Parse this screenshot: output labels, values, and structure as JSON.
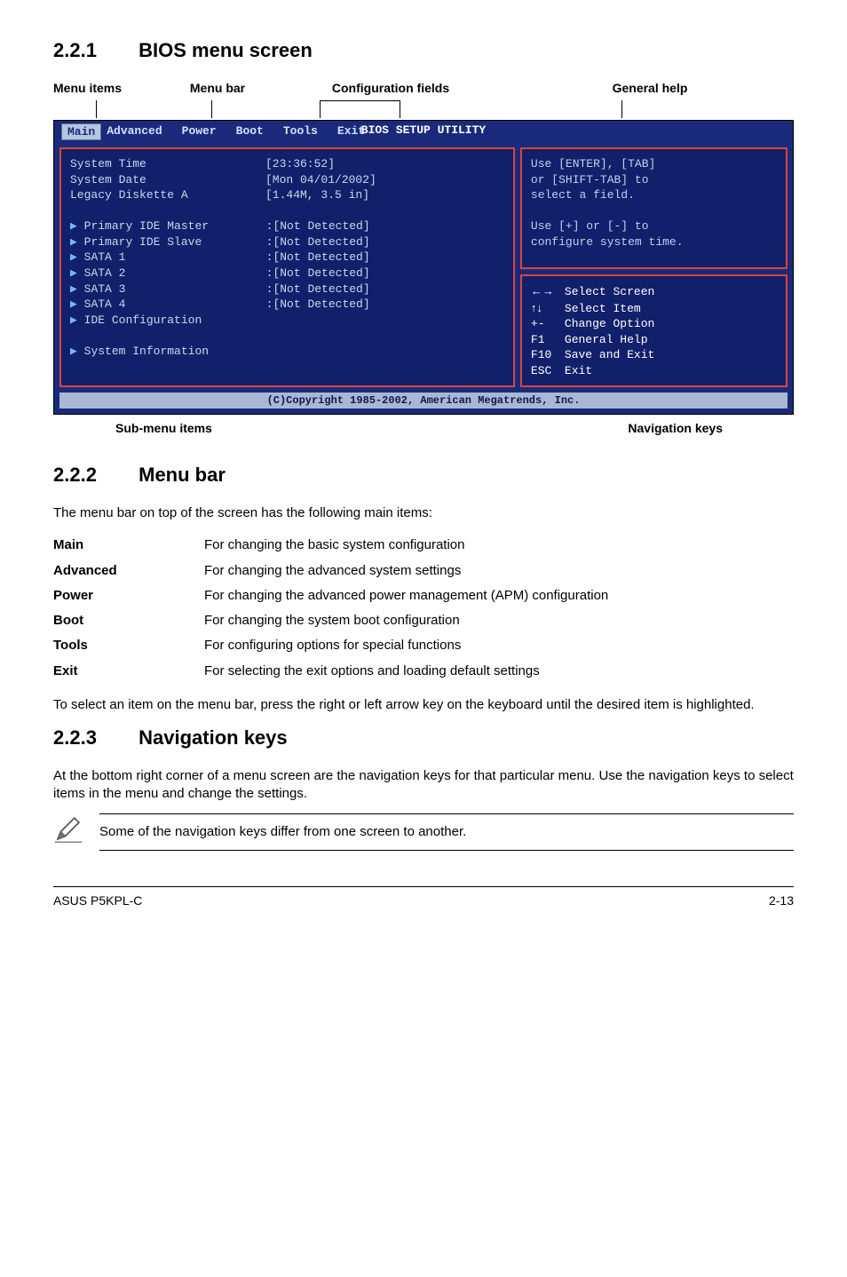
{
  "sections": {
    "s1": {
      "num": "2.2.1",
      "title": "BIOS menu screen"
    },
    "s2": {
      "num": "2.2.2",
      "title": "Menu bar"
    },
    "s3": {
      "num": "2.2.3",
      "title": "Navigation keys"
    }
  },
  "topLabels": {
    "a": "Menu items",
    "b": "Menu bar",
    "c": "Configuration fields",
    "d": "General help"
  },
  "bios": {
    "utilityTitle": "BIOS SETUP UTILITY",
    "menubar": [
      "Main",
      "Advanced",
      "Power",
      "Boot",
      "Tools",
      "Exit"
    ],
    "left": {
      "l1a": "System Time",
      "l1b": "[23:36:52]",
      "l2a": "System Date",
      "l2b": "[Mon 04/01/2002]",
      "l3a": "Legacy Diskette A",
      "l3b": "[1.44M, 3.5 in]",
      "l4a": "Primary IDE Master",
      "l4b": ":[Not Detected]",
      "l5a": "Primary IDE Slave",
      "l5b": ":[Not Detected]",
      "l6a": "SATA 1",
      "l6b": ":[Not Detected]",
      "l7a": "SATA 2",
      "l7b": ":[Not Detected]",
      "l8a": "SATA 3",
      "l8b": ":[Not Detected]",
      "l9a": "SATA 4",
      "l9b": ":[Not Detected]",
      "l10": "IDE Configuration",
      "l11": "System Information"
    },
    "help": {
      "h1": "Use [ENTER], [TAB]",
      "h2": "or [SHIFT-TAB] to",
      "h3": "select a field.",
      "h4": "Use [+] or [-] to",
      "h5": "configure system time."
    },
    "nav": {
      "n1k": "←→",
      "n1t": "Select Screen",
      "n2k": "↑↓",
      "n2t": "Select Item",
      "n3k": "+-",
      "n3t": "Change Option",
      "n4k": "F1",
      "n4t": "General Help",
      "n5k": "F10",
      "n5t": "Save and Exit",
      "n6k": "ESC",
      "n6t": "Exit"
    },
    "copyright": "(C)Copyright 1985-2002, American Megatrends, Inc."
  },
  "subLabels": {
    "left": "Sub-menu items",
    "right": "Navigation keys"
  },
  "menubarText": "The menu bar on top of the screen has the following main items:",
  "defs": {
    "r1k": "Main",
    "r1v": "For changing the basic system configuration",
    "r2k": "Advanced",
    "r2v": "For changing the advanced system settings",
    "r3k": "Power",
    "r3v": "For changing the advanced power management (APM) configuration",
    "r4k": "Boot",
    "r4v": "For changing the system boot configuration",
    "r5k": "Tools",
    "r5v": "For configuring options for special functions",
    "r6k": "Exit",
    "r6v": "For selecting the exit options and loading default settings"
  },
  "menubarTail": "To select an item on the menu bar, press the right or left arrow key on the keyboard until the desired item is highlighted.",
  "navText": "At the bottom right corner of a menu screen are the navigation keys for that particular menu. Use the navigation keys to select items in the menu and change the settings.",
  "note": "Some of the navigation keys differ from one screen to another.",
  "footer": {
    "left": "ASUS P5KPL-C",
    "right": "2-13"
  }
}
